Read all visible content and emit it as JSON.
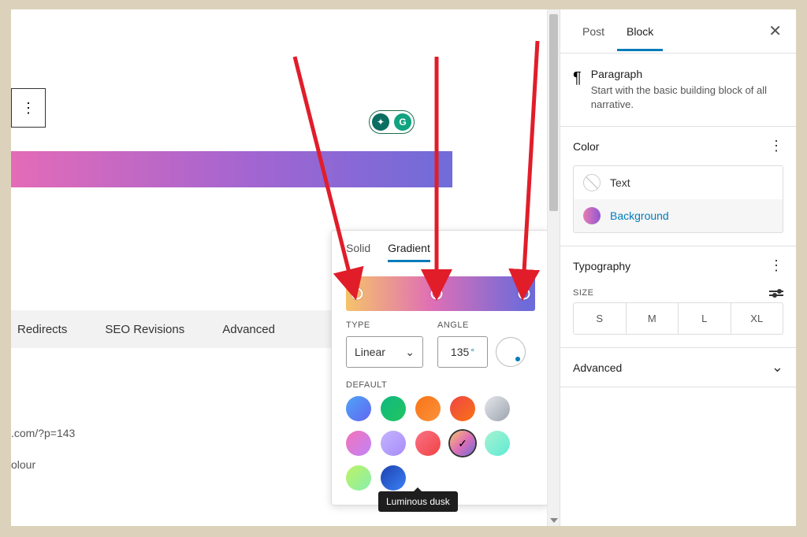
{
  "sidebar": {
    "tabs": {
      "post": "Post",
      "block": "Block"
    },
    "block_info": {
      "title": "Paragraph",
      "desc": "Start with the basic building block of all narrative."
    },
    "color": {
      "title": "Color",
      "text_label": "Text",
      "background_label": "Background"
    },
    "typography": {
      "title": "Typography",
      "size_label": "SIZE",
      "options": [
        "S",
        "M",
        "L",
        "XL"
      ]
    },
    "advanced": {
      "title": "Advanced"
    }
  },
  "main": {
    "tabs": {
      "redirects": "Redirects",
      "seo": "SEO Revisions",
      "advanced": "Advanced"
    },
    "permalink": ".com/?p=143",
    "colour_line": "olour"
  },
  "popover": {
    "solid": "Solid",
    "gradient": "Gradient",
    "type_label": "TYPE",
    "type_value": "Linear",
    "angle_label": "ANGLE",
    "angle_value": "135",
    "angle_unit": "°",
    "default_label": "DEFAULT",
    "tooltip": "Luminous dusk",
    "gradient_stops": [
      6,
      48,
      94
    ]
  },
  "colors": {
    "accent": "#007cba",
    "arrow": "#e11d2a"
  }
}
